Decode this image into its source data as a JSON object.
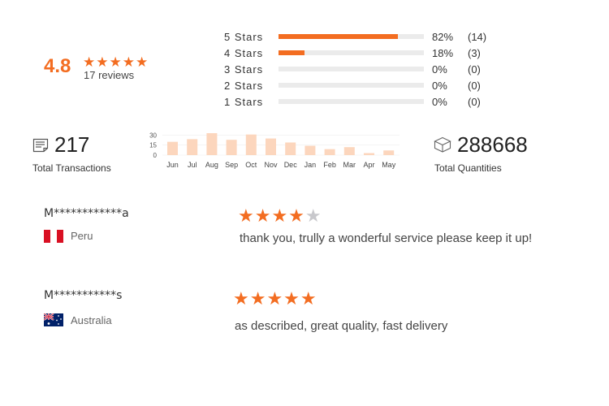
{
  "summary": {
    "score": "4.8",
    "stars": "★★★★★",
    "reviews": "17 reviews",
    "accent_color": "#f36d21"
  },
  "distribution": [
    {
      "label": "5 Stars",
      "pct": "82%",
      "count": "(14)",
      "fraction": 0.82
    },
    {
      "label": "4 Stars",
      "pct": "18%",
      "count": "(3)",
      "fraction": 0.18
    },
    {
      "label": "3 Stars",
      "pct": "0%",
      "count": "(0)",
      "fraction": 0
    },
    {
      "label": "2 Stars",
      "pct": "0%",
      "count": "(0)",
      "fraction": 0
    },
    {
      "label": "1 Stars",
      "pct": "0%",
      "count": "(0)",
      "fraction": 0
    }
  ],
  "stats": {
    "transactions_value": "217",
    "transactions_label": "Total Transactions",
    "quantities_value": "288668",
    "quantities_label": "Total Quantities",
    "transactions_icon": "receipt-icon",
    "quantities_icon": "box-icon"
  },
  "chart_data": {
    "type": "bar",
    "categories": [
      "Jun",
      "Jul",
      "Aug",
      "Sep",
      "Oct",
      "Nov",
      "Dec",
      "Jan",
      "Feb",
      "Mar",
      "Apr",
      "May"
    ],
    "values": [
      20,
      24,
      33,
      23,
      31,
      25,
      19,
      14,
      9,
      12,
      3,
      7
    ],
    "yticks": [
      "30",
      "15",
      "0"
    ],
    "ylim": [
      0,
      33
    ],
    "bar_color": "#fcd6bd",
    "title": "",
    "xlabel": "",
    "ylabel": ""
  },
  "reviews": [
    {
      "name": "M************a",
      "country": "Peru",
      "stars_on": "★★★★",
      "stars_off": "★",
      "rating": 4,
      "text": "thank you, trully a wonderful service please keep it up!",
      "flag_icon": "peru-flag-icon"
    },
    {
      "name": "M***********s",
      "country": "Australia",
      "stars_on": "★★★★★",
      "stars_off": "",
      "rating": 5,
      "text": "as described, great quality, fast delivery",
      "flag_icon": "australia-flag-icon"
    }
  ]
}
